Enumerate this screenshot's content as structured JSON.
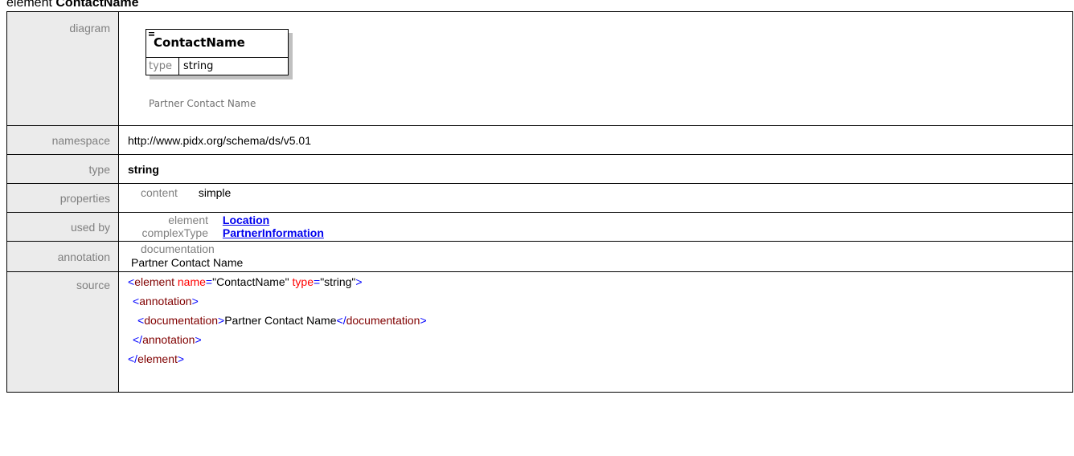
{
  "page": {
    "title_prefix": "element",
    "title_name": "ContactName"
  },
  "rows": {
    "diagram": {
      "label": "diagram"
    },
    "namespace": {
      "label": "namespace",
      "value": "http://www.pidx.org/schema/ds/v5.01"
    },
    "type": {
      "label": "type",
      "value": "string"
    },
    "properties": {
      "label": "properties",
      "key": "content",
      "value": "simple"
    },
    "used_by": {
      "label": "used by",
      "items": [
        {
          "kind": "element",
          "name": "Location"
        },
        {
          "kind": "complexType",
          "name": "PartnerInformation"
        }
      ]
    },
    "annotation": {
      "label": "annotation",
      "key": "documentation",
      "value": "Partner Contact Name"
    },
    "source": {
      "label": "source",
      "lines": {
        "l1_open": "<",
        "l1_tag": "element",
        "l1_attr1": " name",
        "l1_eq1": "=",
        "l1_val1": "\"ContactName\"",
        "l1_attr2": " type",
        "l1_eq2": "=",
        "l1_val2": "\"string\"",
        "l1_close": ">",
        "l2_open": "<",
        "l2_tag": "annotation",
        "l2_close": ">",
        "l3_open": "<",
        "l3_tag": "documentation",
        "l3_close": ">",
        "l3_text": "Partner Contact Name",
        "l3_end_open": "</",
        "l3_end_tag": "documentation",
        "l3_end_close": ">",
        "l4_open": "</",
        "l4_tag": "annotation",
        "l4_close": ">",
        "l5_open": "</",
        "l5_tag": "element",
        "l5_close": ">"
      }
    }
  },
  "diagram": {
    "name": "ContactName",
    "type_label": "type",
    "type_value": "string",
    "caption": "Partner Contact Name"
  }
}
